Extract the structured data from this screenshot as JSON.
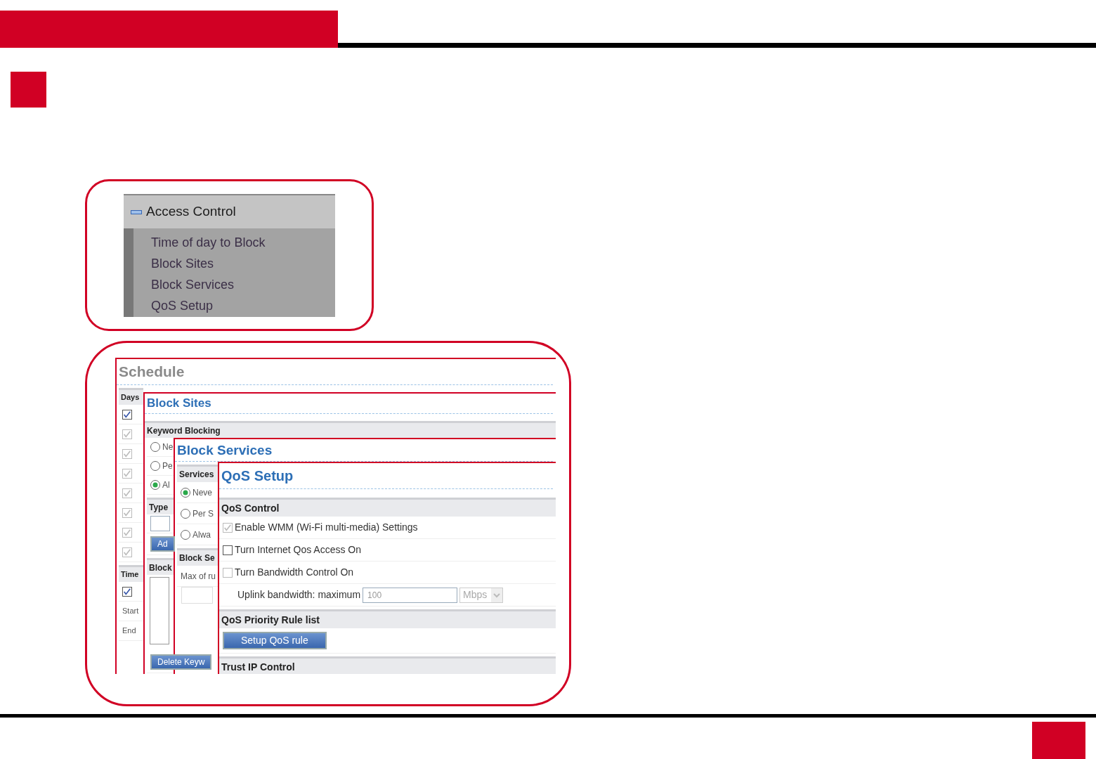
{
  "nav_menu": {
    "title": "Access Control",
    "expanded": true,
    "items": [
      "Time of day to Block",
      "Block Sites",
      "Block Services",
      "QoS Setup"
    ]
  },
  "windows": [
    {
      "title": "Schedule",
      "muted": true,
      "rows": [
        {
          "kind": "section",
          "text": "Days"
        },
        {
          "kind": "check",
          "checked": true,
          "disabled": false
        },
        {
          "kind": "check",
          "checked": true,
          "disabled": true
        },
        {
          "kind": "check",
          "checked": true,
          "disabled": true
        },
        {
          "kind": "check",
          "checked": true,
          "disabled": true
        },
        {
          "kind": "check",
          "checked": true,
          "disabled": true
        },
        {
          "kind": "check",
          "checked": true,
          "disabled": true
        },
        {
          "kind": "check",
          "checked": true,
          "disabled": true
        },
        {
          "kind": "check",
          "checked": true,
          "disabled": true
        },
        {
          "kind": "section",
          "text": "Time"
        },
        {
          "kind": "check",
          "checked": true,
          "disabled": false
        },
        {
          "kind": "text",
          "text": "Start"
        },
        {
          "kind": "text",
          "text": "End"
        }
      ]
    },
    {
      "title": "Block Sites",
      "muted": false,
      "rows": [
        {
          "kind": "section",
          "text": "Keyword Blocking"
        },
        {
          "kind": "radio",
          "label": "Ne",
          "selected": false
        },
        {
          "kind": "radio",
          "label": "Pe",
          "selected": false
        },
        {
          "kind": "radio",
          "label": "Al",
          "selected": true
        },
        {
          "kind": "section",
          "text": "Type"
        },
        {
          "kind": "input"
        },
        {
          "kind": "button",
          "label": "Ad"
        },
        {
          "kind": "section",
          "text": "Block"
        },
        {
          "kind": "textarea"
        },
        {
          "kind": "button",
          "label": "Delete Keyw"
        }
      ]
    },
    {
      "title": "Block Services",
      "muted": false,
      "rows": [
        {
          "kind": "section",
          "text": "Services"
        },
        {
          "kind": "radio",
          "label": "Neve",
          "selected": true
        },
        {
          "kind": "radio",
          "label": "Per S",
          "selected": false
        },
        {
          "kind": "radio",
          "label": "Alwa",
          "selected": false
        },
        {
          "kind": "section",
          "text": "Block Se"
        },
        {
          "kind": "text",
          "text": "Max of ru"
        },
        {
          "kind": "table"
        }
      ]
    },
    {
      "title": "QoS Setup",
      "muted": false,
      "rows": [
        {
          "kind": "section",
          "text": "QoS Control"
        },
        {
          "kind": "check",
          "label": "Enable WMM (Wi-Fi multi-media) Settings",
          "checked": true,
          "disabled": true
        },
        {
          "kind": "check",
          "label": "Turn Internet Qos Access On",
          "checked": false,
          "disabled": false
        },
        {
          "kind": "check",
          "label": "Turn Bandwidth Control On",
          "checked": false,
          "disabled": true
        },
        {
          "kind": "field",
          "label": "Uplink bandwidth: maximum",
          "value": "100",
          "unit": "Mbps"
        },
        {
          "kind": "section",
          "text": "QoS Priority Rule list"
        },
        {
          "kind": "button",
          "label": "Setup QoS rule"
        },
        {
          "kind": "section",
          "text": "Trust IP Control"
        }
      ]
    }
  ]
}
